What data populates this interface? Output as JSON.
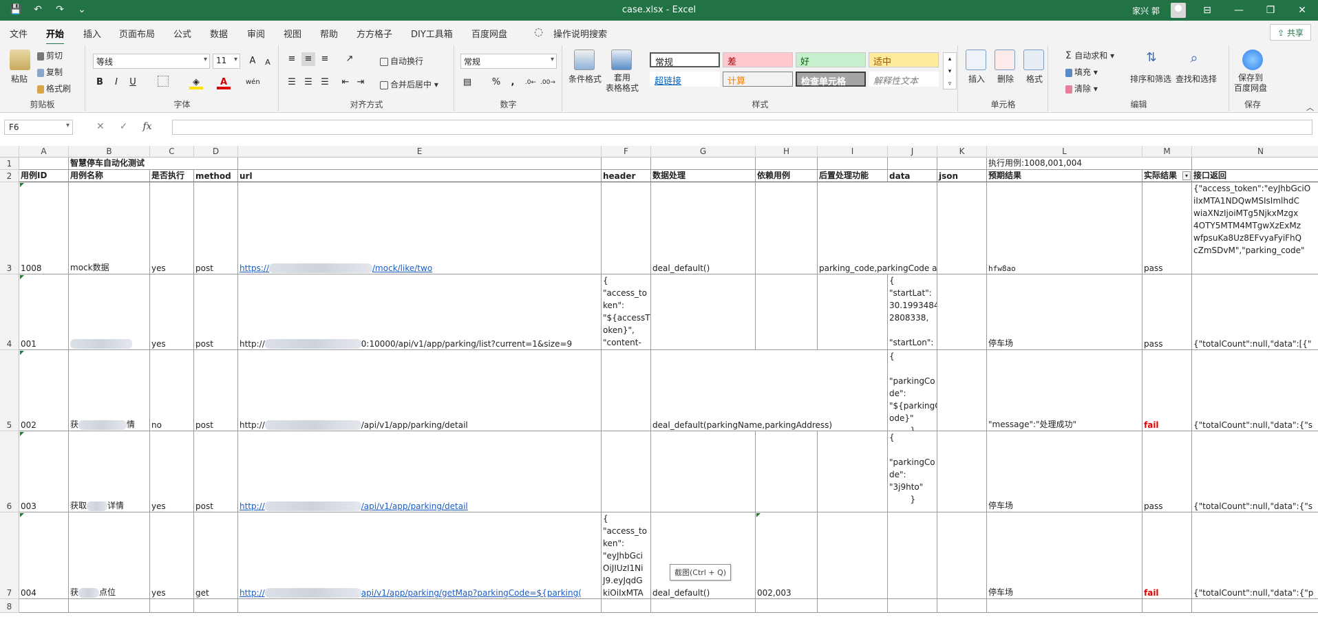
{
  "window": {
    "title": "case.xlsx  -  Excel",
    "user": "家兴 郭",
    "controls": [
      "⊟",
      "—",
      "❐",
      "✕"
    ]
  },
  "quick_access": {
    "save": "💾",
    "undo": "↶",
    "redo": "↷",
    "more": "⌄"
  },
  "tabs": [
    "文件",
    "开始",
    "插入",
    "页面布局",
    "公式",
    "数据",
    "审阅",
    "视图",
    "帮助",
    "方方格子",
    "DIY工具箱",
    "百度网盘",
    "操作说明搜索"
  ],
  "active_tab": "开始",
  "share": "共享",
  "ribbon": {
    "clipboard": {
      "paste": "粘贴",
      "cut": "剪切",
      "copy": "复制",
      "format_painter": "格式刷",
      "label": "剪贴板"
    },
    "font": {
      "name": "等线",
      "size": "11",
      "label": "字体",
      "bold": "B",
      "italic": "I",
      "underline": "U",
      "grow": "A",
      "shrink": "A",
      "phonetic": "wén"
    },
    "alignment": {
      "wrap": "自动换行",
      "merge": "合并后居中",
      "label": "对齐方式"
    },
    "number": {
      "format": "常规",
      "percent": "%",
      "comma": ",",
      "label": "数字"
    },
    "styles": {
      "conditional": "条件格式",
      "table": "套用\n表格格式",
      "normal": "常规",
      "bad": "差",
      "good": "好",
      "neutral": "适中",
      "hyperlink": "超链接",
      "calc": "计算",
      "check": "检查单元格",
      "explain": "解释性文本",
      "label": "样式"
    },
    "cells": {
      "insert": "插入",
      "delete": "删除",
      "format": "格式",
      "label": "单元格"
    },
    "editing": {
      "autosum": "自动求和",
      "fill": "填充",
      "clear": "清除",
      "sort": "排序和筛选",
      "find": "查找和选择",
      "label": "编辑"
    },
    "save": {
      "save_to": "保存到\n百度网盘",
      "label": "保存"
    },
    "colors": {
      "accent": "#217346",
      "bad_bg": "#ffc7ce",
      "bad_fg": "#9c0006",
      "good_bg": "#c6efce",
      "good_fg": "#006100",
      "neutral_bg": "#ffeb9c",
      "neutral_fg": "#9c5700",
      "calc_fg": "#fa7d00",
      "check_bg": "#a5a5a5"
    }
  },
  "formula_bar": {
    "name_box": "F6",
    "cancel": "✕",
    "enter": "✓",
    "fx": "fx",
    "value": ""
  },
  "columns": [
    "A",
    "B",
    "C",
    "D",
    "E",
    "F",
    "G",
    "H",
    "I",
    "J",
    "K",
    "L",
    "M",
    "N"
  ],
  "rows": [
    "1",
    "2",
    "3",
    "4",
    "5",
    "6",
    "7",
    "8"
  ],
  "sheet": {
    "r1": {
      "b": "智慧停车自动化测试",
      "l": "执行用例:1008,001,004"
    },
    "headers": [
      "用例ID",
      "用例名称",
      "是否执行",
      "method",
      "url",
      "header",
      "数据处理",
      "依赖用例",
      "后置处理功能",
      "data",
      "json",
      "预期结果",
      "实际结果",
      "接口返回"
    ],
    "data_rows": [
      {
        "id": "1008",
        "name": "mock数据",
        "exec": "yes",
        "method": "post",
        "url_a": "https://",
        "url_b": "/mock/like/two",
        "header": "",
        "process": "deal_default()",
        "dep": "",
        "post": "parking_code,parkingCode access_token,",
        "data": "",
        "json": "",
        "expected": "hfw8ao",
        "actual": "pass",
        "response": "{\"access_token\":\"eyJhbGciO\niIxMTA1NDQwMSIsImlhdC\nwiaXNzIjoiMTg5NjkxMzgx\n4OTY5MTM4MTgwXzExMz\nwfpsuKa8Uz8EFvyaFyiFhQ\ncZmSDvM\",\"parking_code\""
      },
      {
        "id": "001",
        "name": "",
        "exec": "yes",
        "method": "post",
        "url_a": "http://",
        "url_b": "0:10000/api/v1/app/parking/list?current=1&size=9",
        "header": "{\n\"access_to\nken\":\n\"${accessT\noken}\",\n\"content-",
        "process": "",
        "dep": "",
        "post": "",
        "data": "{\n\"startLat\":\n30.1993484\n2808338,\n\n\"startLon\":",
        "json": "",
        "expected": "停车场",
        "actual": "pass",
        "response": "{\"totalCount\":null,\"data\":[{\""
      },
      {
        "id": "002",
        "name_a": "获",
        "name_b": "情",
        "exec": "no",
        "method": "post",
        "url_a": "http://",
        "url_b": "/api/v1/app/parking/detail",
        "header": "",
        "process": "deal_default(parkingName,parkingAddress)",
        "dep": "",
        "post": "",
        "data": "{\n\n\"parkingCo\nde\":\n\"${parkingC\node}\"\n        }",
        "json": "",
        "expected": "\"message\":\"处理成功\"",
        "actual": "fail",
        "response": "{\"totalCount\":null,\"data\":{\"s"
      },
      {
        "id": "003",
        "name_a": "获取",
        "name_b": "详情",
        "exec": "yes",
        "method": "post",
        "url_a": "http://",
        "url_b": "/api/v1/app/parking/detail",
        "header": "",
        "process": "",
        "dep": "",
        "post": "",
        "data": "{\n\n\"parkingCo\nde\":\n\"3j9hto\"\n        }",
        "json": "",
        "expected": "停车场",
        "actual": "pass",
        "response": "{\"totalCount\":null,\"data\":{\"s"
      },
      {
        "id": "004",
        "name_a": "获",
        "name_b": "点位",
        "exec": "yes",
        "method": "get",
        "url_a": "http://",
        "url_b": "api/v1/app/parking/getMap?parkingCode=${parking(",
        "header": "{\n\"access_to\nken\":\n\"eyJhbGci\nOiJIUzI1Ni\nJ9.eyJqdG\nkiOiIxMTA",
        "process": "deal_default()",
        "dep": "002,003",
        "post": "",
        "data": "",
        "json": "",
        "expected": "停车场",
        "actual": "fail",
        "response": "{\"totalCount\":null,\"data\":{\"p"
      }
    ]
  },
  "tooltip": "截图(Ctrl + Q)"
}
